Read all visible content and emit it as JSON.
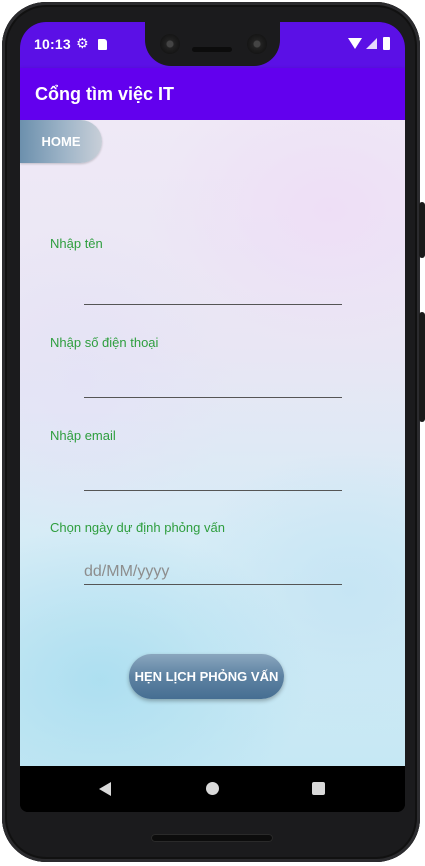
{
  "status_bar": {
    "time": "10:13",
    "icons": [
      "gear-icon",
      "sd-card-icon",
      "wifi-icon",
      "signal-icon",
      "battery-icon"
    ]
  },
  "app_bar": {
    "title": "Cổng tìm việc IT",
    "color": "#6200ee",
    "status_color": "#5b10e6"
  },
  "home_button": {
    "label": "HOME"
  },
  "form": {
    "name": {
      "label": "Nhập tên",
      "value": ""
    },
    "phone": {
      "label": "Nhập số điện thoại",
      "value": ""
    },
    "email": {
      "label": "Nhập email",
      "value": ""
    },
    "date": {
      "label": "Chọn ngày dự định phỏng vấn",
      "value": "dd/MM/yyyy"
    },
    "label_color": "#2e9e3e"
  },
  "submit_button": {
    "label": "HẸN LỊCH PHỎNG VẤN"
  },
  "nav_bar": {
    "icons": [
      "back-icon",
      "home-icon",
      "recents-icon"
    ]
  }
}
